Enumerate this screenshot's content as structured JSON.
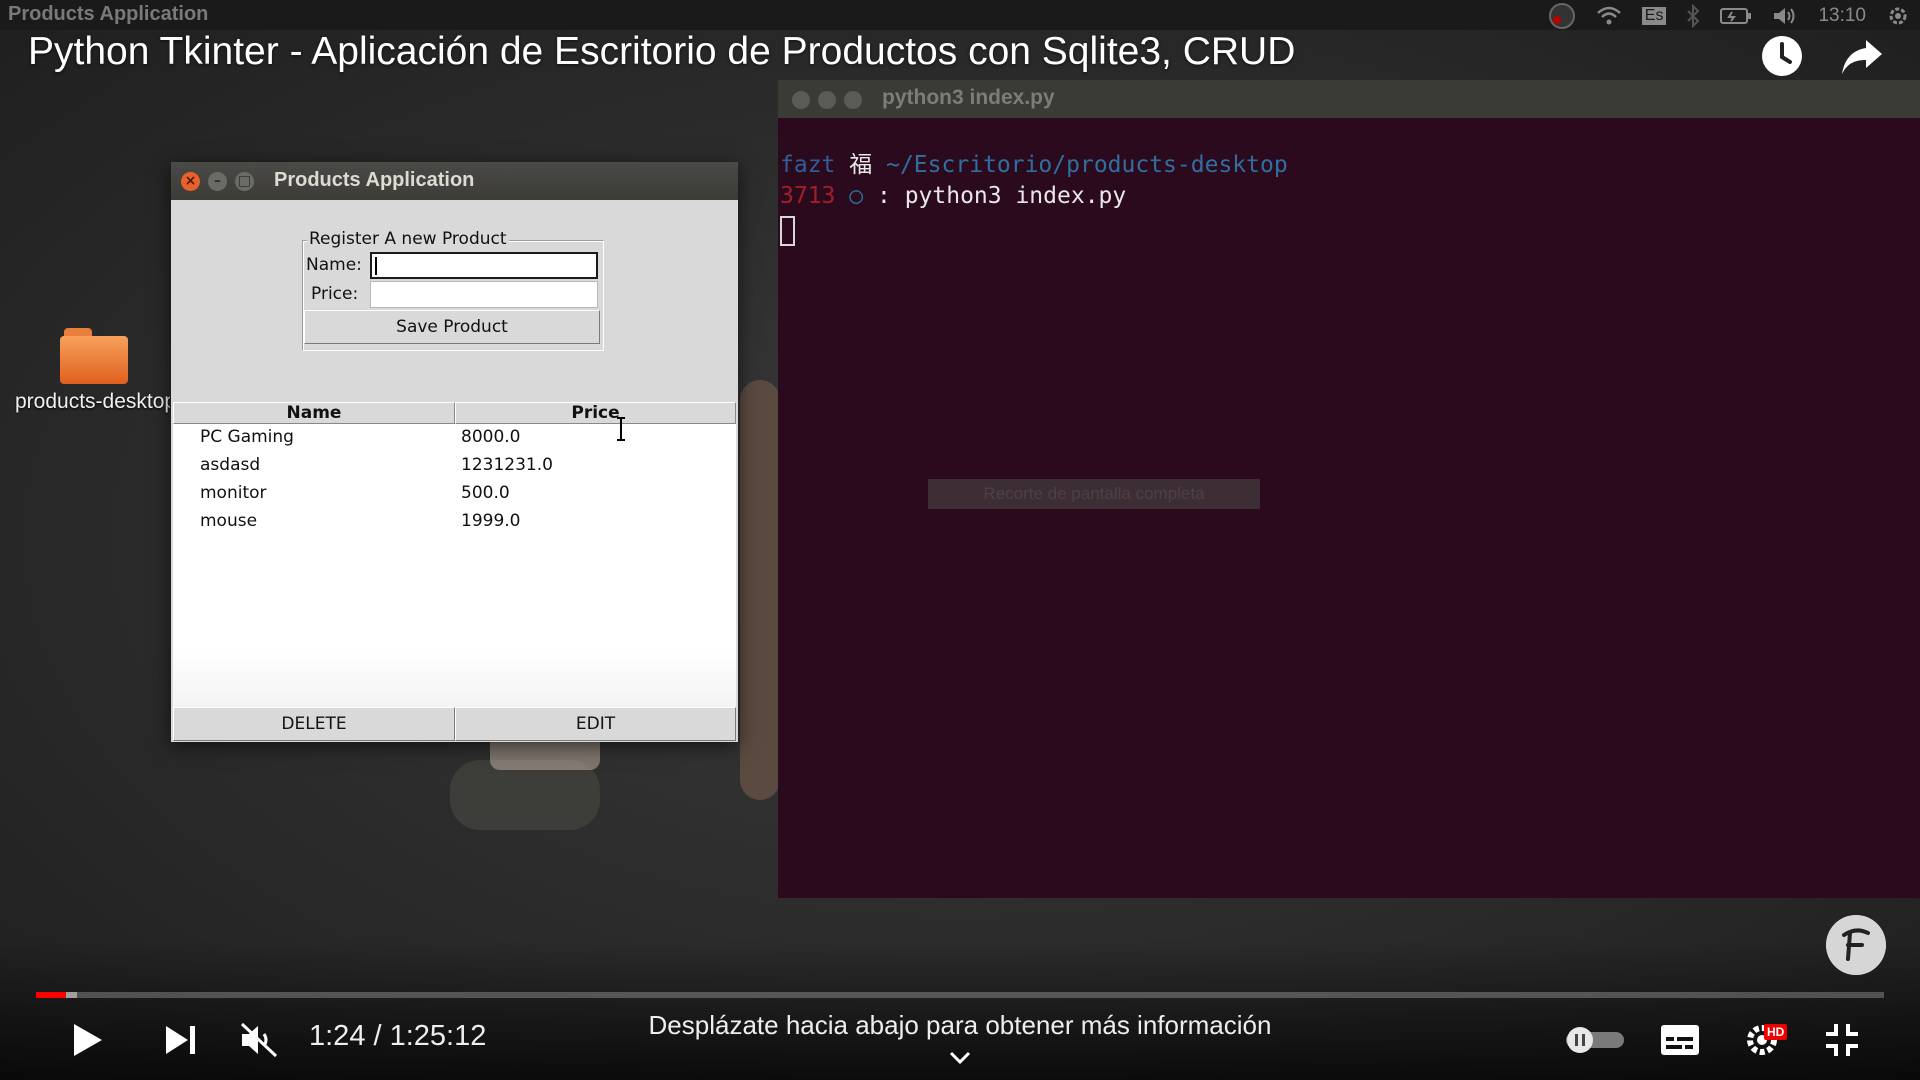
{
  "topbar": {
    "app_name": "Products Application",
    "keyboard_layout": "Es",
    "clock": "13:10"
  },
  "video": {
    "title": "Python Tkinter - Aplicación de Escritorio de Productos con Sqlite3, CRUD",
    "progress_fraction": 0.0162,
    "buffered_fraction": 0.022
  },
  "desktop": {
    "folder_label": "products-desktop"
  },
  "terminal": {
    "title": "python3 index.py",
    "prompt_user": "fazt",
    "prompt_symbol": "福",
    "prompt_path": "~/Escritorio/products-desktop",
    "line_number": "3713",
    "circle": "○",
    "separator": ":",
    "command": "python3 index.py"
  },
  "notification": {
    "text": "Recorte de pantalla completa"
  },
  "tk_app": {
    "title": "Products Application",
    "frame_label": "Register A new Product",
    "name_label": "Name:",
    "price_label": "Price:",
    "name_value": "",
    "price_value": "",
    "save_button": "Save Product",
    "columns": [
      "Name",
      "Price"
    ],
    "rows": [
      {
        "name": "PC Gaming",
        "price": "8000.0"
      },
      {
        "name": "asdasd",
        "price": "1231231.0"
      },
      {
        "name": "monitor",
        "price": "500.0"
      },
      {
        "name": "mouse",
        "price": "1999.0"
      }
    ],
    "delete_button": "DELETE",
    "edit_button": "EDIT"
  },
  "player": {
    "time": "1:24 / 1:25:12",
    "scroll_hint": "Desplázate hacia abajo para obtener más información",
    "hd_badge": "HD",
    "autoplay_on": false,
    "muted": true
  }
}
